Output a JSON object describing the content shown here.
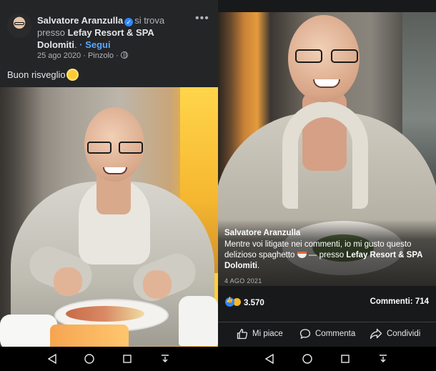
{
  "left_post": {
    "author": "Salvatore Aranzulla",
    "checkin_text": "si trova presso",
    "place": "Lefay Resort & SPA Dolomiti",
    "follow_label": "Segui",
    "date": "25 ago 2020",
    "location": "Pinzolo",
    "text": "Buon risveglio",
    "more_label": "•••"
  },
  "right_post": {
    "caption_author": "Salvatore Aranzulla",
    "caption_text": "Mentre voi litigate nei commenti, io mi gusto questo delizioso spaghetto",
    "caption_presso": "— presso",
    "caption_place": "Lefay Resort & SPA Dolomiti",
    "date": "4 AGO 2021",
    "reactions_count": "3.570",
    "comments_label": "Commenti: 714",
    "actions": {
      "like": "Mi piace",
      "comment": "Commenta",
      "share": "Condividi"
    }
  },
  "icons": {
    "verified": "verified-badge-icon",
    "globe": "globe-icon",
    "sun": "sun-emoji-icon",
    "like": "like-reaction-icon",
    "laugh": "laugh-reaction-icon"
  },
  "colors": {
    "background": "#18191a",
    "header": "#242526",
    "text": "#e4e6eb",
    "secondary": "#b0b3b8",
    "link": "#5aa7ff",
    "verified": "#2d88ff"
  }
}
